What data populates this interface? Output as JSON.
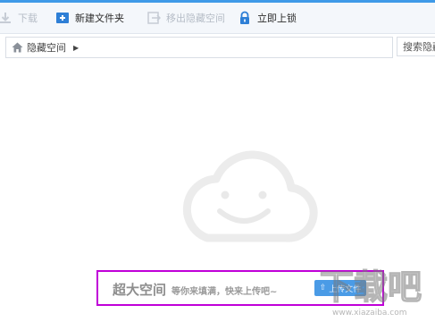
{
  "toolbar": {
    "download_label": "下载",
    "new_folder_label": "新建文件夹",
    "move_out_label": "移出隐藏空间",
    "lock_label": "立即上锁"
  },
  "path": {
    "current": "隐藏空间"
  },
  "search": {
    "placeholder": "搜索隐藏"
  },
  "empty_state": {
    "headline": "超大空间",
    "subline": "等你来填满，快来上传吧~",
    "upload_button": "上传文件"
  },
  "watermark": {
    "text": "下载吧",
    "url": "www.xiazaiba.com"
  },
  "colors": {
    "accent": "#3f9ae8",
    "highlight_frame": "#c000d8",
    "disabled_text": "#b6bdc7"
  }
}
